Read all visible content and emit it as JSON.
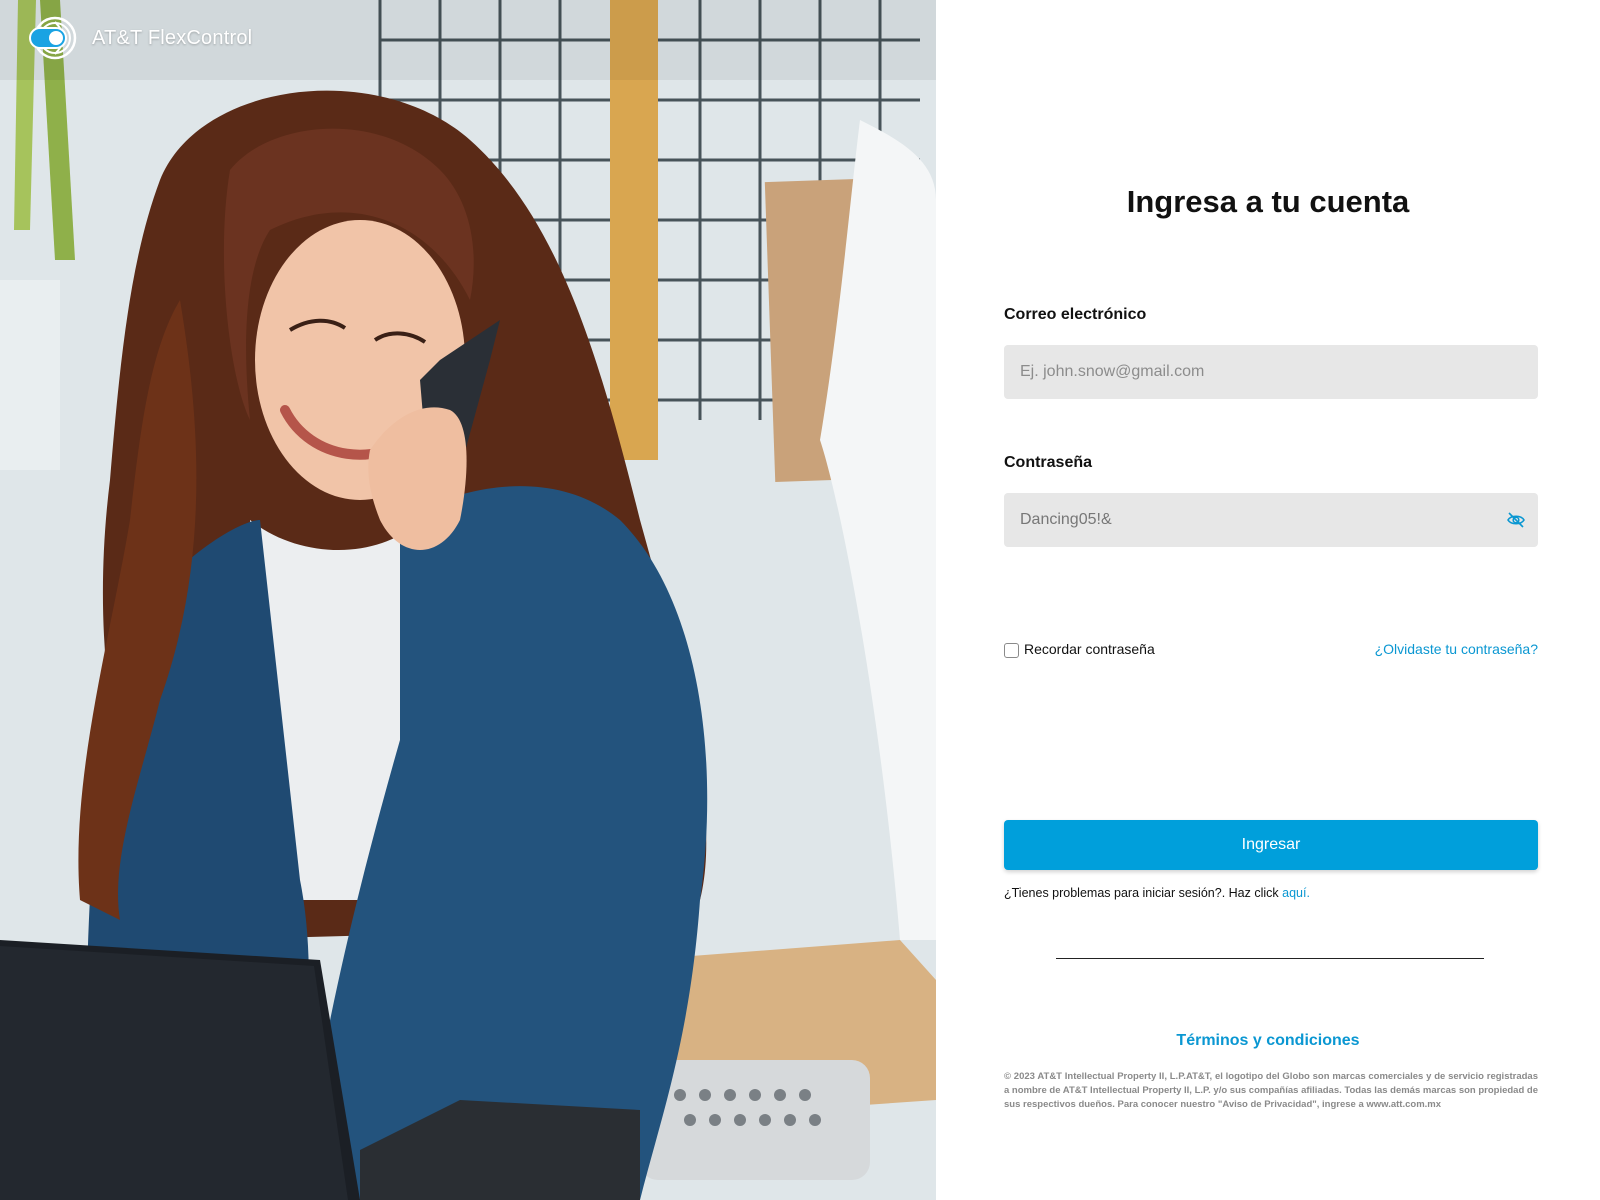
{
  "brand": {
    "name": "AT&T FlexControl",
    "logo_icon": "toggle-globe-logo-icon",
    "accent": "#009fdb"
  },
  "hero": {
    "image_description": "photo"
  },
  "login": {
    "title": "Ingresa a tu cuenta",
    "email": {
      "label": "Correo electrónico",
      "placeholder": "Ej. john.snow@gmail.com",
      "value": ""
    },
    "password": {
      "label": "Contraseña",
      "value": "Dancing05!&",
      "visibility_icon": "eye-slash-icon"
    },
    "remember_label": "Recordar contraseña",
    "forgot_label": "¿Olvidaste tu contraseña?",
    "submit_label": "Ingresar",
    "trouble_text": "¿Tienes problemas para iniciar sesión?. Haz click",
    "trouble_link": "aquí.",
    "terms_label": "Términos y condiciones",
    "legal_text": "© 2023 AT&T Intellectual Property II, L.P.AT&T, el logotipo del Globo son marcas comerciales y de servicio registradas a nombre de AT&T Intellectual Property II, L.P. y/o sus compañías afiliadas. Todas las demás marcas son propiedad de sus respectivos dueños. Para conocer nuestro \"Aviso de Privacidad\", ingrese a www.att.com.mx"
  },
  "colors": {
    "link": "#0a97d2",
    "button": "#009fdb",
    "field_bg": "#e7e7e7"
  }
}
